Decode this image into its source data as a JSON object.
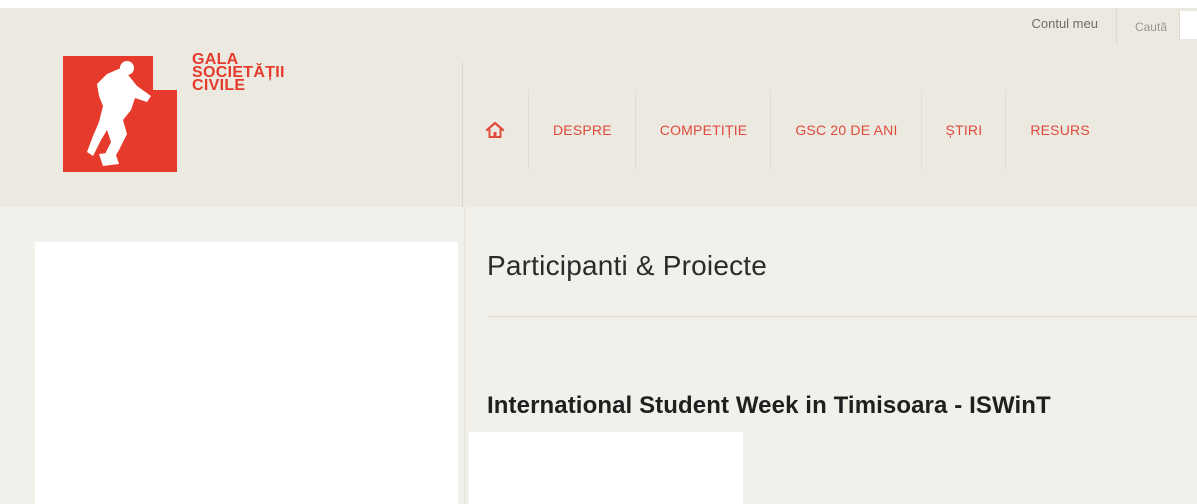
{
  "logo": {
    "lines": [
      "GALA",
      "SOCIETĂȚII",
      "CIVILE"
    ],
    "icon": "climbing-figure-logo",
    "brand_color": "#e53a2c"
  },
  "utility": {
    "account_link": "Contul meu",
    "search_label": "Caută"
  },
  "nav": {
    "home_icon": "home-icon",
    "items": [
      {
        "label": "DESPRE"
      },
      {
        "label": "COMPETIȚIE"
      },
      {
        "label": "GSC 20 DE ANI"
      },
      {
        "label": "ȘTIRI"
      },
      {
        "label": "RESURS"
      }
    ],
    "color": "#e04a3b"
  },
  "main": {
    "page_title": "Participanti & Proiecte",
    "project_title": "International Student Week in Timisoara - ISWinT"
  }
}
